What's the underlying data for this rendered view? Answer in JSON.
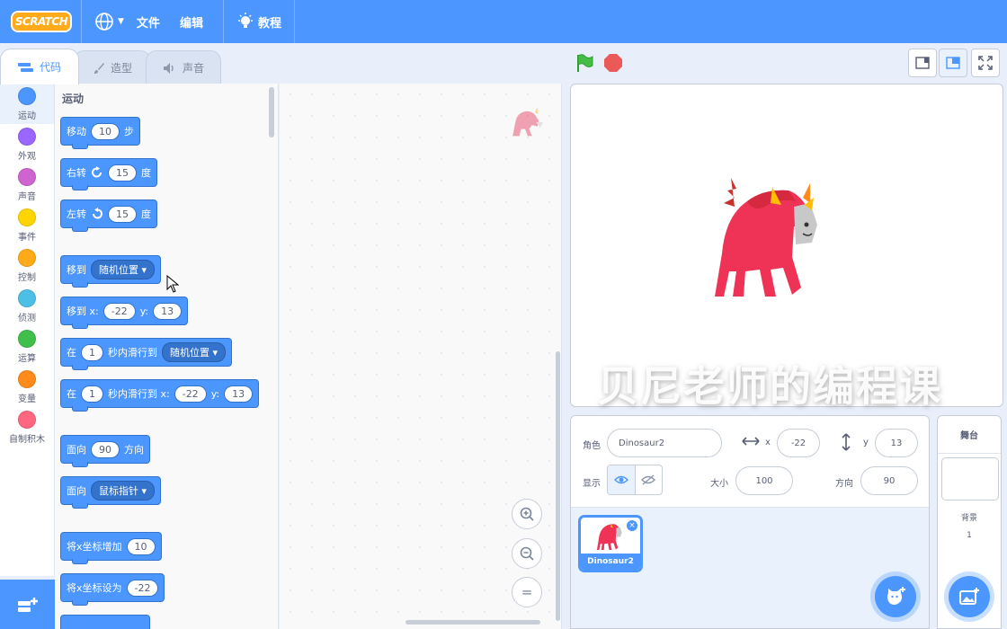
{
  "menu": {
    "logo": "SCRATCH",
    "file": "文件",
    "edit": "编辑",
    "tutorials": "教程"
  },
  "tabs": [
    {
      "label": "代码"
    },
    {
      "label": "造型"
    },
    {
      "label": "声音"
    }
  ],
  "categories": [
    {
      "label": "运动",
      "color": "#4c97ff"
    },
    {
      "label": "外观",
      "color": "#9966ff"
    },
    {
      "label": "声音",
      "color": "#cf63cf"
    },
    {
      "label": "事件",
      "color": "#ffd500"
    },
    {
      "label": "控制",
      "color": "#ffab19"
    },
    {
      "label": "侦测",
      "color": "#4cbfe6"
    },
    {
      "label": "运算",
      "color": "#40bf4a"
    },
    {
      "label": "变量",
      "color": "#ff8c1a"
    },
    {
      "label": "自制积木",
      "color": "#ff6680"
    }
  ],
  "palette": {
    "heading": "运动",
    "move": {
      "a": "移动",
      "n": "10",
      "b": "步"
    },
    "turn_right": {
      "a": "右转",
      "n": "15",
      "b": "度"
    },
    "turn_left": {
      "a": "左转",
      "n": "15",
      "b": "度"
    },
    "goto": {
      "a": "移到",
      "opt": "随机位置"
    },
    "goto_xy": {
      "a": "移到 x:",
      "x": "-22",
      "ylab": "y:",
      "y": "13"
    },
    "glide": {
      "a": "在",
      "n": "1",
      "b": "秒内滑行到",
      "opt": "随机位置"
    },
    "glide_xy": {
      "a": "在",
      "n": "1",
      "b": "秒内滑行到 x:",
      "x": "-22",
      "ylab": "y:",
      "y": "13"
    },
    "point_dir": {
      "a": "面向",
      "n": "90",
      "b": "方向"
    },
    "point_to": {
      "a": "面向",
      "opt": "鼠标指针"
    },
    "change_x": {
      "a": "将x坐标增加",
      "n": "10"
    },
    "set_x": {
      "a": "将x坐标设为",
      "n": "-22"
    }
  },
  "zoom": {
    "reset": "="
  },
  "watermark": "贝尼老师的编程课",
  "sprite_info": {
    "sprite_label": "角色",
    "sprite_name": "Dinosaur2",
    "x_label": "x",
    "x": "-22",
    "y_label": "y",
    "y": "13",
    "show_label": "显示",
    "size_label": "大小",
    "size": "100",
    "direction_label": "方向",
    "direction": "90"
  },
  "sprites": [
    {
      "name": "Dinosaur2"
    }
  ],
  "stage_panel": {
    "title": "舞台",
    "backdrop_label": "背景",
    "backdrop_count": "1"
  }
}
